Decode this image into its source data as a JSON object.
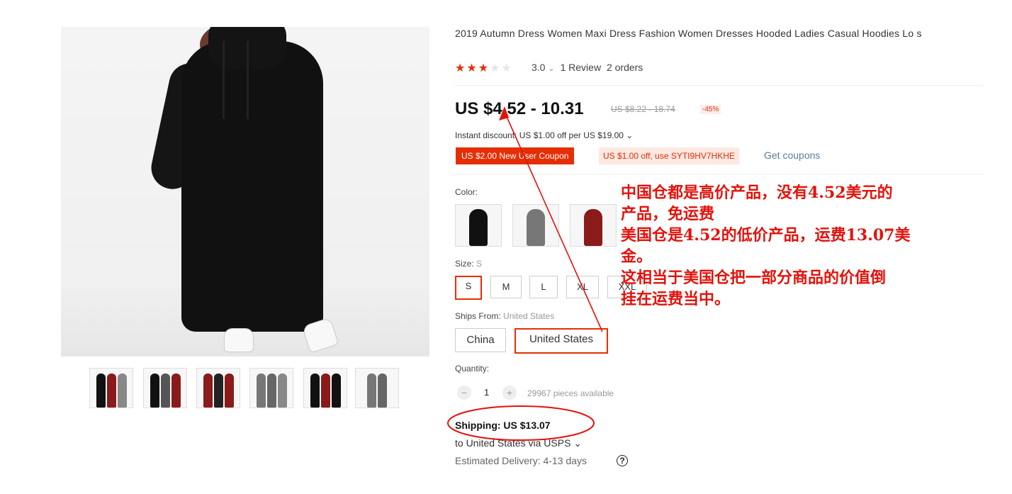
{
  "product": {
    "title": "2019 Autumn Dress Women Maxi Dress Fashion Women Dresses Hooded Ladies Casual Hoodies Lo s",
    "rating_value": "3.0",
    "rating_caret": "⌄",
    "reviews": "1 Review",
    "orders": "2 orders",
    "stars_filled": 3,
    "stars_total": 5
  },
  "price": {
    "current": "US $4.52 - 10.31",
    "original": "US $8.22 - 18.74",
    "discount": "-45%"
  },
  "promo": {
    "instant": "Instant discount: US $1.00 off per US $19.00 ⌄",
    "new_user_coupon": "US $2.00 New User Coupon",
    "code_coupon": "US $1.00 off, use SYTI9HV7HKHE",
    "get_coupons": "Get coupons"
  },
  "options": {
    "color_label": "Color:",
    "size_label": "Size:",
    "size_selected": "S",
    "sizes": [
      "S",
      "M",
      "L",
      "XL",
      "XXL"
    ],
    "ships_from_label": "Ships From:",
    "ships_from_selected": "United States",
    "ships_from": [
      "China",
      "United States"
    ]
  },
  "quantity": {
    "label": "Quantity:",
    "minus": "−",
    "plus": "+",
    "value": "1",
    "available": "29967 pieces available"
  },
  "shipping": {
    "cost": "Shipping: US $13.07",
    "route": "to United States via USPS ⌄",
    "estimate": "Estimated Delivery: 4-13 days",
    "help": "?"
  },
  "annotation": {
    "text": "中国仓都是高价产品，没有4.52美元的\n产品，免运费\n美国仓是4.52的低价产品，运费13.07美\n金。\n这相当于美国仓把一部分商品的价值倒\n挂在运费当中。"
  },
  "colors": {
    "accent": "#e62e04",
    "annotation": "#e3120b"
  }
}
